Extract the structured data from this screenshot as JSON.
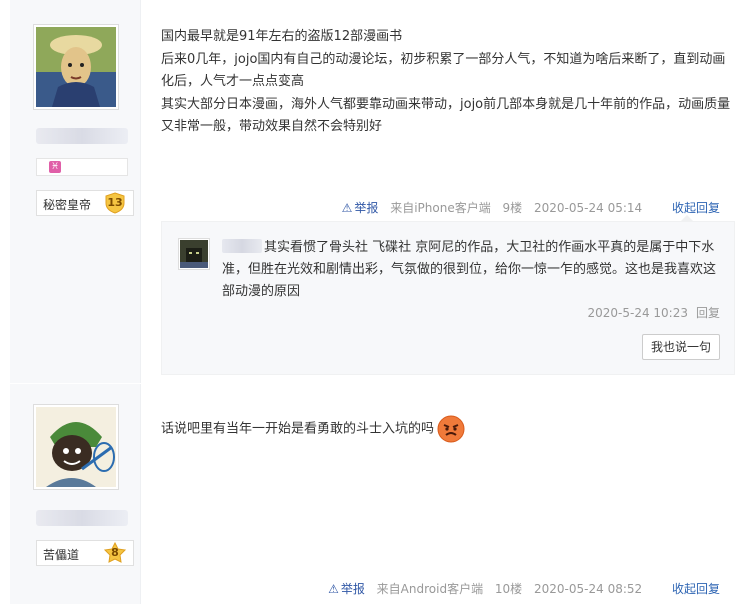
{
  "posts": [
    {
      "user": {
        "name_blurred": true,
        "zodiac_symbol": "♓",
        "badge_name": "秘密皇帝",
        "badge_level": "13"
      },
      "content_lines": [
        "国内最早就是91年左右的盗版12部漫画书",
        "后来0几年，jojo国内有自己的动漫论坛，初步积累了一部分人气，不知道为啥后来断了，直到动画化后，人气才一点点变高",
        "其实大部分日本漫画，海外人气都要靠动画来带动，jojo前几部本身就是几十年前的作品，动画质量又非常一般，带动效果自然不会特别好"
      ],
      "tail": {
        "report": "举报",
        "source": "来自iPhone客户端",
        "floor": "9楼",
        "time": "2020-05-24 05:14",
        "reply_toggle": "收起回复"
      },
      "reply": {
        "text": "其实看惯了骨头社 飞碟社 京阿尼的作品，大卫社的作画水平真的是属于中下水准，但胜在光效和剧情出彩，气氛做的很到位，给你一惊一乍的感觉。这也是我喜欢这部动漫的原因",
        "time": "2020-5-24 10:23",
        "reply_btn": "回复",
        "say_btn": "我也说一句"
      }
    },
    {
      "user": {
        "name_blurred": true,
        "badge_name": "苦儡道",
        "badge_level": "8"
      },
      "content_lines": [
        "话说吧里有当年一开始是看勇敢的斗士入坑的吗"
      ],
      "tail": {
        "report": "举报",
        "source": "来自Android客户端",
        "floor": "10楼",
        "time": "2020-05-24 08:52",
        "reply_toggle": "收起回复"
      }
    }
  ]
}
